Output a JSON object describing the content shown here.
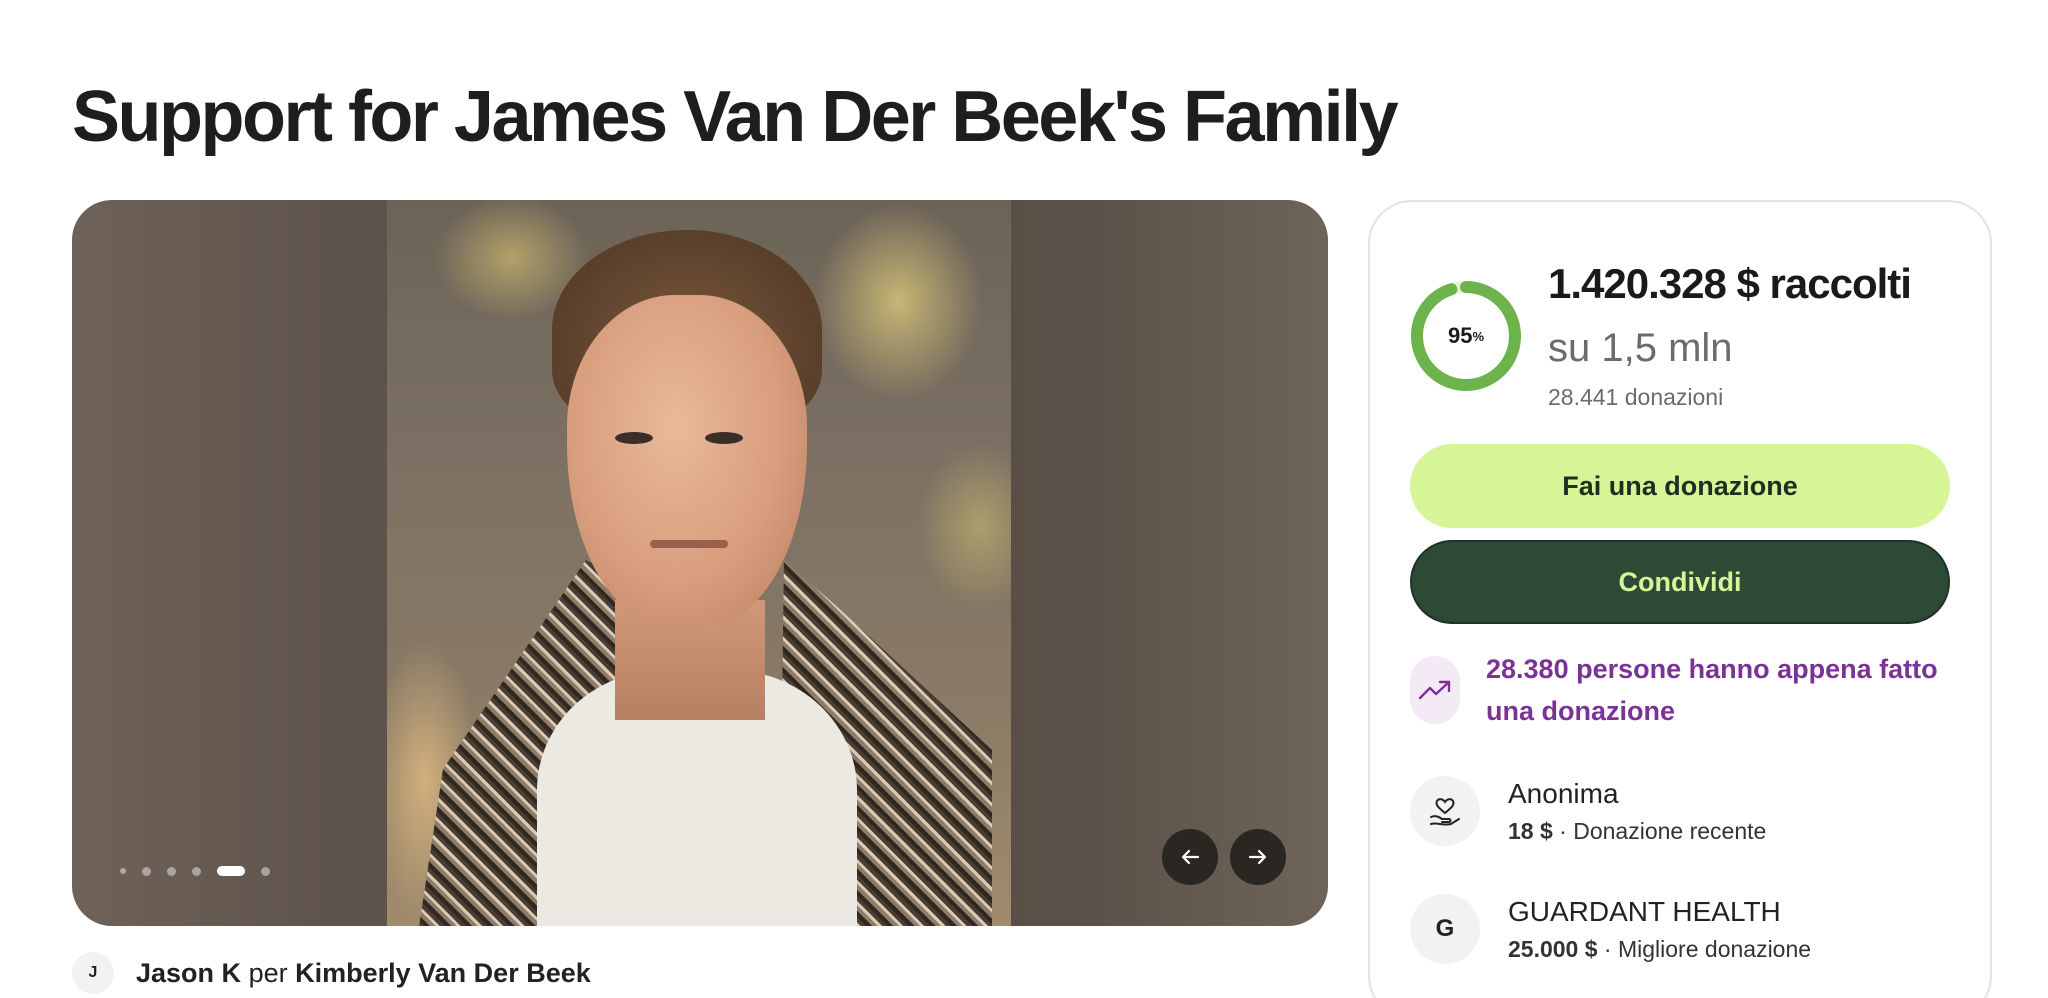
{
  "page": {
    "title": "Support for James Van Der Beek's Family"
  },
  "carousel": {
    "slide_count": 6,
    "active_index": 4,
    "prev_icon": "arrow-left-icon",
    "next_icon": "arrow-right-icon"
  },
  "organizer": {
    "avatar_initial": "J",
    "name": "Jason K",
    "connector": "per",
    "beneficiary": "Kimberly Van Der Beek"
  },
  "progress": {
    "percent_value": 95,
    "percent_number": "95",
    "percent_sign": "%",
    "raised": "1.420.328 $ raccolti",
    "goal": "su 1,5 mln",
    "donations_count": "28.441 donazioni",
    "ring_color": "#6bb34a",
    "ring_track_color": "#e6f3d8"
  },
  "actions": {
    "donate_label": "Fai una donazione",
    "share_label": "Condividi",
    "donate_color": "#d6f596",
    "share_color": "#2d4a36"
  },
  "trend": {
    "icon": "trending-up-icon",
    "text": "28.380 persone hanno appena fatto una donazione",
    "color": "#7b3296"
  },
  "donors": [
    {
      "icon": "heart-hand-icon",
      "initial": "",
      "name": "Anonima",
      "amount": "18 $",
      "separator": " · ",
      "label": "Donazione recente"
    },
    {
      "icon": "initial-avatar",
      "initial": "G",
      "name": "GUARDANT HEALTH",
      "amount": "25.000 $",
      "separator": " · ",
      "label": "Migliore donazione"
    }
  ]
}
